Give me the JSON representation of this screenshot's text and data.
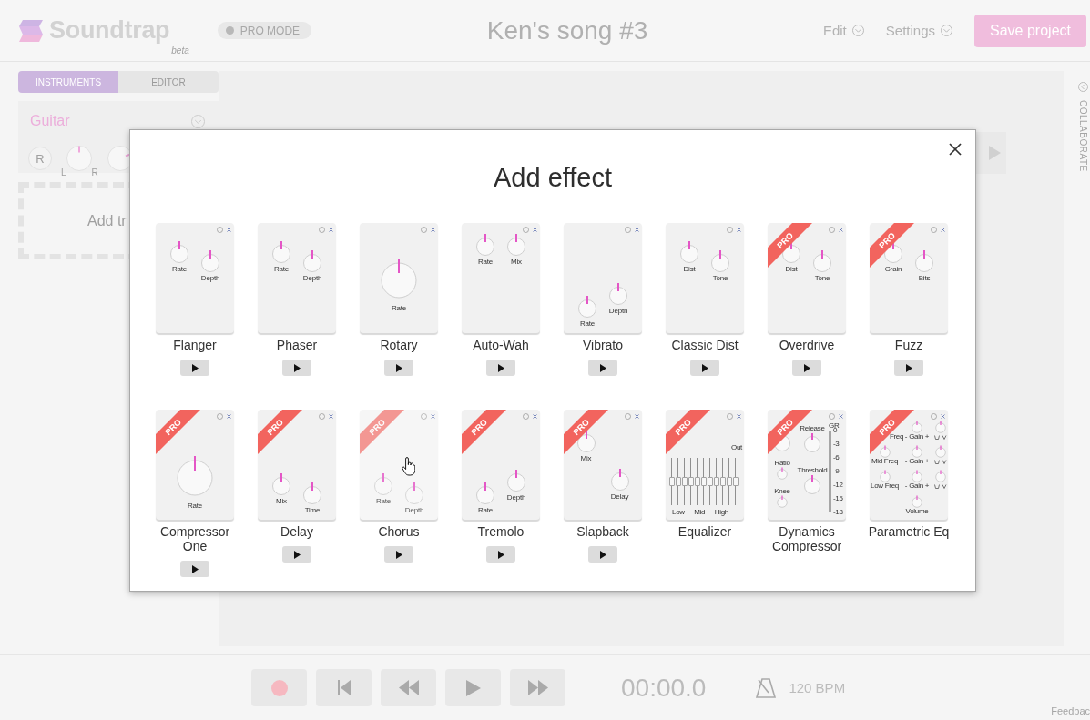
{
  "header": {
    "logo": "Soundtrap",
    "logo_tag": "beta",
    "mode": {
      "label": "PRO MODE",
      "on": false
    },
    "title": "Ken's song #3",
    "menus": [
      "Edit",
      "Settings"
    ],
    "save_label": "Save project"
  },
  "sidebar": {
    "tabs": [
      {
        "label": "INSTRUMENTS",
        "selected": true
      },
      {
        "label": "EDITOR",
        "selected": false
      }
    ],
    "track": {
      "name": "Guitar",
      "record_label": "R",
      "pan": {
        "level": 0.5,
        "left": "L",
        "right": "R"
      },
      "volume": {
        "level": 0.75
      }
    },
    "add_track": "Add tr"
  },
  "collaborate": "COLLABORATE",
  "modal": {
    "title": "Add effect",
    "effects": [
      {
        "name": "Flanger",
        "kind": "staggered",
        "hovered": false,
        "preview": true,
        "knobs": [
          {
            "label": "Rate"
          },
          {
            "label": "Depth"
          }
        ]
      },
      {
        "name": "Phaser",
        "kind": "staggered",
        "hovered": false,
        "preview": true,
        "knobs": [
          {
            "label": "Rate"
          },
          {
            "label": "Depth"
          }
        ]
      },
      {
        "name": "Rotary",
        "kind": "single",
        "hovered": false,
        "preview": true,
        "knobs": [
          {
            "label": "Rate"
          }
        ]
      },
      {
        "name": "Auto-Wah",
        "kind": "paired",
        "hovered": false,
        "preview": true,
        "knobs": [
          {
            "label": "Rate"
          },
          {
            "label": "Mix"
          }
        ]
      },
      {
        "name": "Vibrato",
        "kind": "rising",
        "hovered": false,
        "preview": true,
        "knobs": [
          {
            "label": "Rate"
          },
          {
            "label": "Depth"
          }
        ]
      },
      {
        "name": "Classic Dist",
        "kind": "staggered",
        "hovered": false,
        "preview": true,
        "knobs": [
          {
            "label": "Dist"
          },
          {
            "label": "Tone"
          }
        ]
      },
      {
        "name": "Overdrive",
        "kind": "staggered",
        "badge": "PRO",
        "hovered": false,
        "preview": true,
        "knobs": [
          {
            "label": "Dist"
          },
          {
            "label": "Tone"
          }
        ]
      },
      {
        "name": "Fuzz",
        "kind": "staggered",
        "badge": "PRO",
        "hovered": false,
        "preview": true,
        "knobs": [
          {
            "label": "Grain"
          },
          {
            "label": "Bits"
          }
        ]
      },
      {
        "name": "Compressor One",
        "kind": "anchored",
        "badge": "PRO",
        "hovered": false,
        "preview": true,
        "knobs": [
          {
            "label": "Rate"
          }
        ]
      },
      {
        "name": "Delay",
        "kind": "sinking",
        "badge": "PRO",
        "hovered": false,
        "preview": true,
        "knobs": [
          {
            "label": "Mix"
          },
          {
            "label": "Time"
          }
        ]
      },
      {
        "name": "Chorus",
        "kind": "sinking",
        "badge": "PRO",
        "hovered": true,
        "preview": true,
        "knobs": [
          {
            "label": "Rate"
          },
          {
            "label": "Depth"
          }
        ]
      },
      {
        "name": "Tremolo",
        "kind": "rising",
        "badge": "PRO",
        "hovered": false,
        "preview": true,
        "knobs": [
          {
            "label": "Rate"
          },
          {
            "label": "Depth"
          }
        ]
      },
      {
        "name": "Slapback",
        "kind": "split",
        "badge": "PRO",
        "hovered": false,
        "preview": true,
        "knobs": [
          {
            "label": "Mix"
          },
          {
            "label": "Delay"
          }
        ]
      },
      {
        "name": "Equalizer",
        "kind": "equalizer",
        "badge": "PRO",
        "hovered": false,
        "preview": false,
        "out_label": "Out",
        "faders": [
          {
            "level": 0.5
          },
          {
            "level": 0.5
          },
          {
            "level": 0.5
          },
          {
            "level": 0.5
          },
          {
            "level": 0.5
          },
          {
            "level": 0.5
          },
          {
            "level": 0.5
          },
          {
            "level": 0.5
          },
          {
            "level": 0.5
          },
          {
            "level": 0.5
          },
          {
            "level": 0.5
          }
        ],
        "band_labels": [
          "Low",
          "Mid",
          "High"
        ]
      },
      {
        "name": "Dynamics Compressor",
        "kind": "dynamics",
        "badge": "PRO",
        "hovered": false,
        "preview": false,
        "knobs": [
          {
            "label": "Release"
          },
          {
            "label": "Ratio"
          },
          {
            "label": "Threshold"
          },
          {
            "label": "Knee"
          }
        ],
        "meter": {
          "label": "GR",
          "scale": [
            "0",
            "-3",
            "-6",
            "-9",
            "-12",
            "-15",
            "-18"
          ]
        }
      },
      {
        "name": "Parametric Eq",
        "kind": "parametric",
        "badge": "PRO",
        "hovered": false,
        "preview": false,
        "bands": [
          {
            "freq": "Freq",
            "gain": "- Gain +"
          },
          {
            "freq": "Mid Freq",
            "gain": "- Gain +"
          },
          {
            "freq": "Low Freq",
            "gain": "- Gain +"
          }
        ],
        "volume_label": "Volume"
      }
    ]
  },
  "transport": {
    "time": "00:00.0",
    "tempo": "120 BPM",
    "feedback": "Feedbac"
  }
}
